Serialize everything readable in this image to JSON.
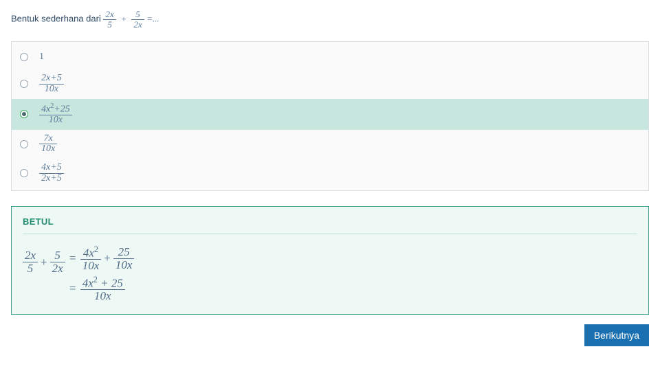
{
  "question": {
    "prefix": "Bentuk sederhana dari ",
    "expr": {
      "frac1_num": "2x",
      "frac1_den": "5",
      "frac2_num": "5",
      "frac2_den": "2x"
    },
    "suffix": " =..."
  },
  "options": [
    {
      "type": "plain",
      "text": "1",
      "selected": false
    },
    {
      "type": "frac",
      "num": "2x+5",
      "den": "10x",
      "selected": false
    },
    {
      "type": "frac_sq",
      "num_a": "4x",
      "num_exp": "2",
      "num_b": "+25",
      "den": "10x",
      "selected": true
    },
    {
      "type": "frac",
      "num": "7x",
      "den": "10x",
      "selected": false
    },
    {
      "type": "frac",
      "num": "4x+5",
      "den": "2x+5",
      "selected": false
    }
  ],
  "feedback": {
    "title": "BETUL",
    "lhs": {
      "f1n": "2x",
      "f1d": "5",
      "f2n": "5",
      "f2d": "2x"
    },
    "step1": {
      "f1n_a": "4x",
      "f1n_exp": "2",
      "f1d": "10x",
      "f2n": "25",
      "f2d": "10x"
    },
    "step2": {
      "num_a": "4x",
      "num_exp": "2",
      "num_b": " + 25",
      "den": "10x"
    }
  },
  "next_label": "Berikutnya"
}
